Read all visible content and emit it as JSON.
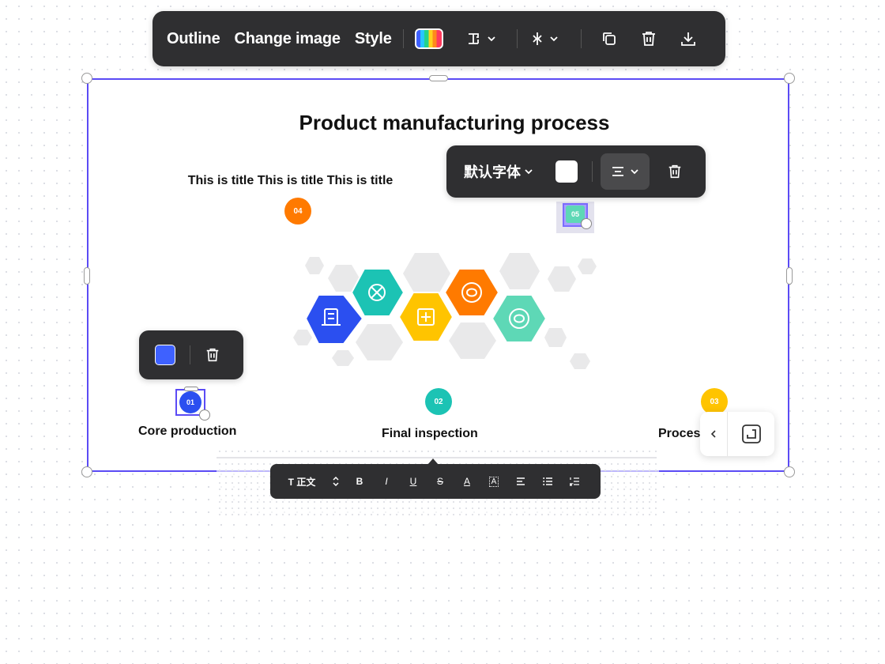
{
  "toolbar": {
    "outline": "Outline",
    "change_image": "Change image",
    "style": "Style",
    "icons": [
      "palette-icon",
      "layout-icon",
      "align-icon",
      "copy-icon",
      "trash-icon",
      "download-icon"
    ]
  },
  "slide": {
    "title": "Product manufacturing process",
    "subtitle": "This is title This is title This is title",
    "steps": [
      {
        "number": "01",
        "label": "Core production",
        "color": "#2b4ff0"
      },
      {
        "number": "02",
        "label": "Final inspection",
        "color": "#1cc3b4"
      },
      {
        "number": "03",
        "label": "Proces",
        "color": "#ffc400"
      },
      {
        "number": "04",
        "label": "",
        "color": "#ff7a00"
      },
      {
        "number": "05",
        "label": "",
        "color": "#5ed8b6"
      }
    ],
    "border_color": "#5b4bf5"
  },
  "font_toolbar": {
    "font_name": "默认字体",
    "swatch_color": "#ffffff"
  },
  "color_toolbar": {
    "swatch_color": "#3e61ff"
  },
  "format_toolbar": {
    "style_label": "T 正文",
    "bold": "B",
    "italic": "I",
    "underline": "U",
    "strike": "S",
    "font_color": "A",
    "highlight": "A"
  }
}
